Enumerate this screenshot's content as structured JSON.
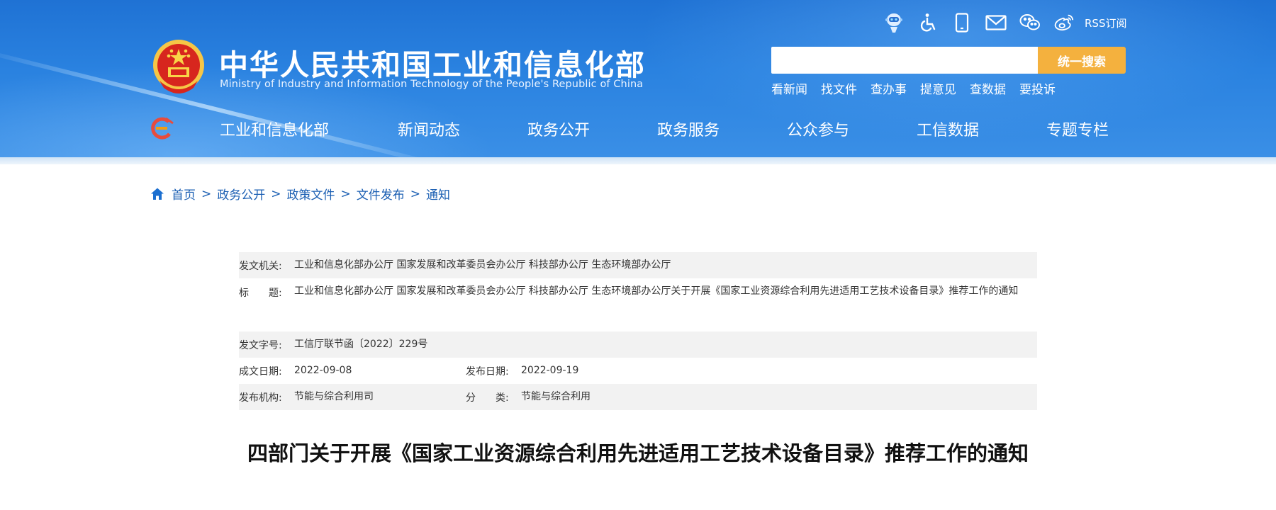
{
  "header": {
    "title": "中华人民共和国工业和信息化部",
    "subtitle": "Ministry of Industry and Information Technology of the People's Republic of China",
    "icons": [
      "robot-assistant-icon",
      "accessibility-icon",
      "mobile-icon",
      "mail-icon",
      "wechat-icon",
      "weibo-icon"
    ],
    "rss_label": "RSS订阅",
    "search": {
      "placeholder": "",
      "button_label": "统一搜索"
    },
    "quick_links": [
      "看新闻",
      "找文件",
      "查办事",
      "提意见",
      "查数据",
      "要投诉"
    ],
    "nav": [
      "工业和信息化部",
      "新闻动态",
      "政务公开",
      "政务服务",
      "公众参与",
      "工信数据",
      "专题专栏"
    ]
  },
  "breadcrumb": [
    "首页",
    "政务公开",
    "政策文件",
    "文件发布",
    "通知"
  ],
  "meta": {
    "issuer_label": "发文机关:",
    "issuer": "工业和信息化部办公厅 国家发展和改革委员会办公厅 科技部办公厅 生态环境部办公厅",
    "title_label": "标　　题:",
    "title": "工业和信息化部办公厅 国家发展和改革委员会办公厅 科技部办公厅 生态环境部办公厅关于开展《国家工业资源综合利用先进适用工艺技术设备目录》推荐工作的通知",
    "doc_no_label": "发文字号:",
    "doc_no": "工信厅联节函〔2022〕229号",
    "written_date_label": "成文日期:",
    "written_date": "2022-09-08",
    "publish_date_label": "发布日期:",
    "publish_date": "2022-09-19",
    "publisher_label": "发布机构:",
    "publisher": "节能与综合利用司",
    "category_label": "分　　类:",
    "category": "节能与综合利用"
  },
  "document_title": "四部门关于开展《国家工业资源综合利用先进适用工艺技术设备目录》推荐工作的通知",
  "colors": {
    "header_blue": "#2a82e0",
    "search_button": "#f4b13e",
    "link_blue": "#1b5fb3",
    "meta_shade": "#f2f2f2"
  }
}
